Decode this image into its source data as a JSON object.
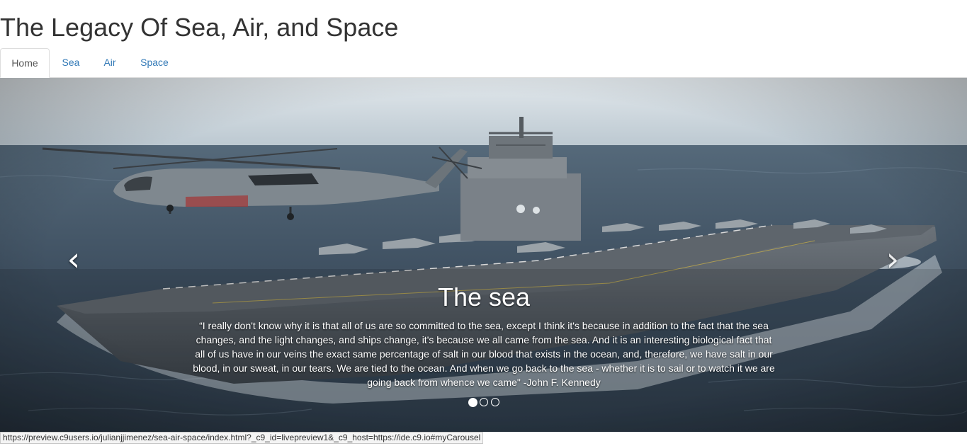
{
  "header": {
    "title": "The Legacy Of Sea, Air, and Space"
  },
  "nav": {
    "tabs": [
      {
        "label": "Home",
        "active": true
      },
      {
        "label": "Sea",
        "active": false
      },
      {
        "label": "Air",
        "active": false
      },
      {
        "label": "Space",
        "active": false
      }
    ]
  },
  "carousel": {
    "prev_icon": "chevron-left-icon",
    "next_icon": "chevron-right-icon",
    "prev_glyph": "‹",
    "next_glyph": "›",
    "slide": {
      "image": "aircraft-carrier-and-navy-helicopter-at-sea",
      "title": "The sea",
      "text": "“I really don't know why it is that all of us are so committed to the sea, except I think it's because in addition to the fact that the sea changes, and the light changes, and ships change, it's because we all came from the sea. And it is an interesting biological fact that all of us have in our veins the exact same percentage of salt in our blood that exists in the ocean, and, therefore, we have salt in our blood, in our sweat, in our tears. We are tied to the ocean. And when we go back to the sea - whether it is to sail or to watch it we are going back from whence we came\" -John F. Kennedy"
    },
    "indicators": {
      "count": 3,
      "active_index": 0
    }
  },
  "status_bar": {
    "url": "https://preview.c9users.io/julianjjimenez/sea-air-space/index.html?_c9_id=livepreview1&_c9_host=https://ide.c9.io#myCarousel"
  },
  "colors": {
    "link": "#337ab7",
    "title_text": "#333333",
    "sea": "#3d4c5b",
    "sky": "#d6dde2"
  }
}
